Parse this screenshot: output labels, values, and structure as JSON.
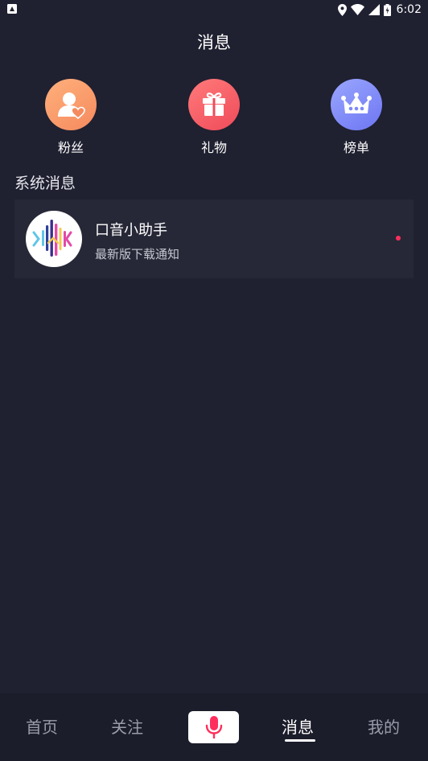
{
  "status_bar": {
    "time": "6:02"
  },
  "header": {
    "title": "消息"
  },
  "shortcuts": [
    {
      "label": "粉丝",
      "icon": "fans-icon",
      "color": "#f79a6b"
    },
    {
      "label": "礼物",
      "icon": "gift-icon",
      "color": "#f4606a"
    },
    {
      "label": "榜单",
      "icon": "crown-icon",
      "color": "#7f89f6"
    }
  ],
  "system_messages": {
    "section_title": "系统消息",
    "items": [
      {
        "name": "口音小助手",
        "preview": "最新版下载通知",
        "unread": true,
        "avatar_icon": "soundwave-logo-icon"
      }
    ]
  },
  "bottom_nav": {
    "items": [
      "首页",
      "关注",
      "消息",
      "我的"
    ],
    "active": "消息",
    "record_icon": "microphone-icon",
    "accent_color": "#ff2e5c"
  }
}
